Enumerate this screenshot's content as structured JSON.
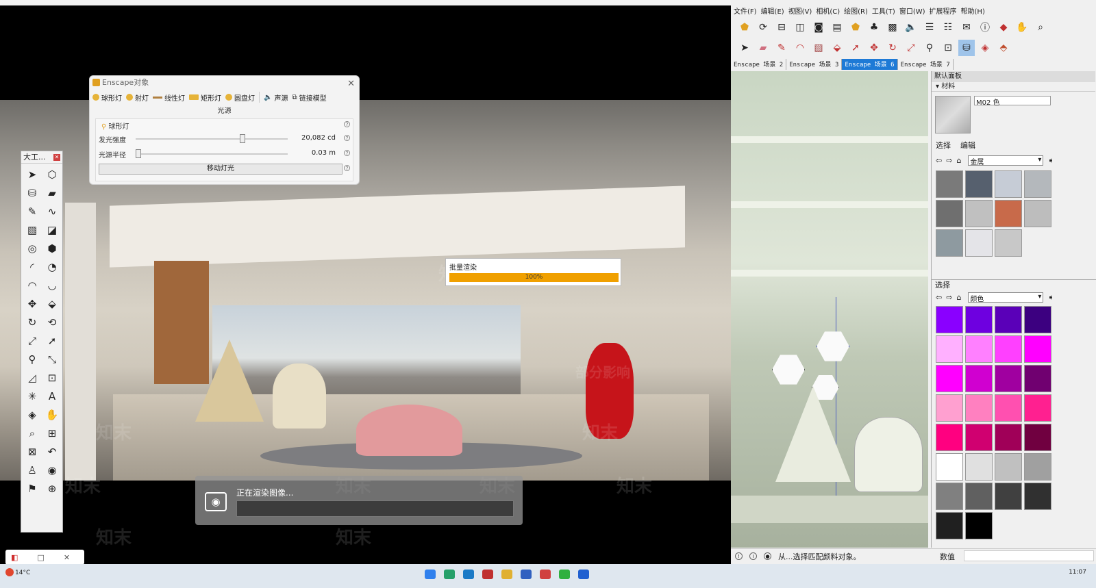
{
  "enscape_window": {
    "title": "Enscape对象",
    "light_types": [
      "球形灯",
      "射灯",
      "线性灯",
      "矩形灯",
      "圆盘灯"
    ],
    "sound_label": "声源",
    "link_model_label": "链接模型",
    "group_label": "光源",
    "section_label": "球形灯",
    "intensity_label": "发光强度",
    "intensity_value": "20,082 cd",
    "intensity_level": 0.71,
    "radius_label": "光源半径",
    "radius_value": "0.03 m",
    "radius_level": 0.0,
    "move_light_label": "移动灯光"
  },
  "floating_toolbar": {
    "title": "大工...",
    "tools": [
      "select-icon",
      "component-icon",
      "paint-bucket-icon",
      "eraser-icon",
      "pencil-icon",
      "freehand-icon",
      "rectangle-icon",
      "rotated-rectangle-icon",
      "circle-icon",
      "polygon-icon",
      "arc-icon",
      "pie-icon",
      "two-point-arc-icon",
      "three-point-arc-icon",
      "move-icon",
      "push-pull-icon",
      "rotate-icon",
      "follow-me-icon",
      "scale-icon",
      "offset-icon",
      "tape-measure-icon",
      "dimension-icon",
      "protractor-icon",
      "text-icon",
      "axes-icon",
      "3d-text-icon",
      "orbit-icon",
      "pan-icon",
      "zoom-icon",
      "zoom-window-icon",
      "zoom-extents-icon",
      "previous-view-icon",
      "position-camera-icon",
      "look-around-icon",
      "walk-icon",
      "section-plane-icon"
    ]
  },
  "batch_progress": {
    "label": "批量渲染",
    "percent_text": "100%",
    "fraction": 1.0
  },
  "rendering_overlay": {
    "text": "正在渲染图像..."
  },
  "watermarks": [
    "知末",
    "知末",
    "知末",
    "知末",
    "知末",
    "知末",
    "知末",
    "知末",
    "知末",
    "部分影响"
  ],
  "sketchup": {
    "menu": [
      "文件(F)",
      "编辑(E)",
      "视图(V)",
      "相机(C)",
      "绘图(R)",
      "工具(T)",
      "窗口(W)",
      "扩展程序",
      "帮助(H)"
    ],
    "scene_tabs": [
      "Enscape 场景 2",
      "Enscape 场景 3",
      "Enscape 场景 6",
      "Enscape 场景 7"
    ],
    "active_scene_index": 2,
    "tray": {
      "title": "默认面板",
      "materials_label": "材料",
      "material_name": "M02 色",
      "tab_select": "选择",
      "tab_edit": "编辑",
      "library_select": "金属",
      "second_select_label": "选择",
      "color_select": "颜色"
    },
    "metal_swatches": [
      "#7a7a7a",
      "#56606e",
      "#c6ccd6",
      "#b4b8bc",
      "#6f6f6f",
      "#c0c0c0",
      "#c86a4a",
      "#bdbdbd",
      "#8e9aa0",
      "#e4e4e8",
      "#c8c8c8"
    ],
    "color_swatches": [
      "#8a00ff",
      "#6e00e0",
      "#5a00b8",
      "#3c0080",
      "#ffb0ff",
      "#ff80ff",
      "#ff40ff",
      "#ff00ff",
      "#ff00ff",
      "#d000d0",
      "#a000a0",
      "#700070",
      "#ffa0d0",
      "#ff80c0",
      "#ff50b0",
      "#ff2090",
      "#ff0080",
      "#d00070",
      "#a00058",
      "#700040",
      "#ffffff",
      "#e0e0e0",
      "#c0c0c0",
      "#a0a0a0",
      "#808080",
      "#606060",
      "#404040",
      "#303030",
      "#202020",
      "#000000"
    ],
    "status_text": "从...选择匹配颜料对象。",
    "measurement_label": "数值"
  },
  "minibar": {
    "labels": [
      "□",
      "✕"
    ]
  },
  "taskbar": {
    "weather": "14°C",
    "clock": "11:07"
  }
}
